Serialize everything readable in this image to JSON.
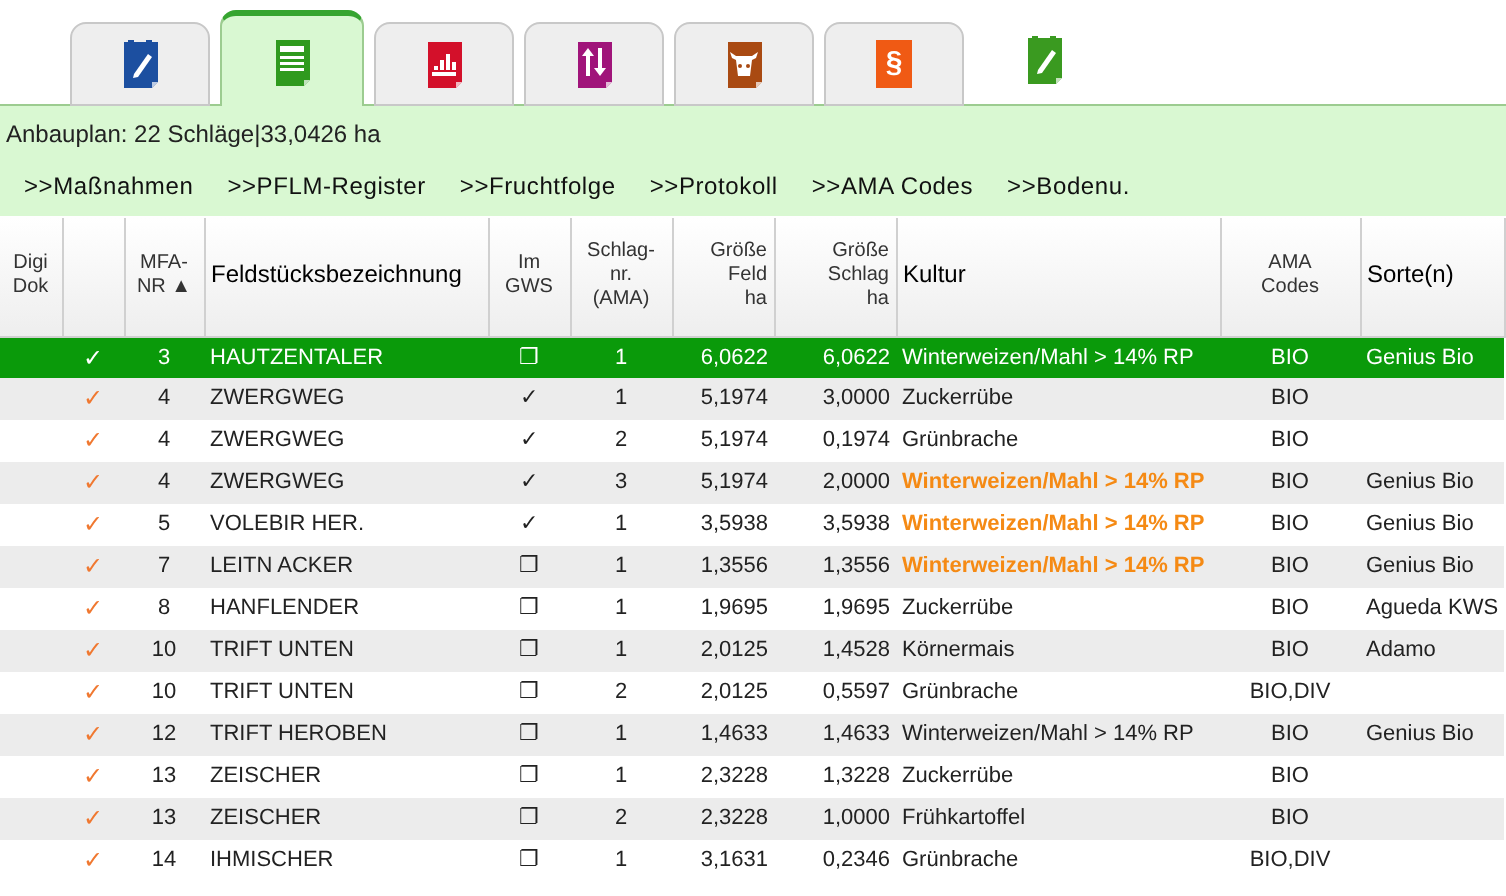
{
  "tabs": [
    {
      "selected": false
    },
    {
      "selected": true
    },
    {
      "selected": false
    },
    {
      "selected": false
    },
    {
      "selected": false
    },
    {
      "glyph": "§",
      "selected": false
    },
    {
      "selected": false
    }
  ],
  "summary": "Anbauplan: 22 Schläge|33,0426 ha",
  "links": [
    ">>Maßnahmen",
    ">>PFLM-Register",
    ">>Fruchtfolge",
    ">>Protokoll",
    ">>AMA Codes",
    ">>Bodenu."
  ],
  "table": {
    "columns": [
      "Digi\nDok",
      "",
      "MFA-\nNR ▲",
      "Feldstücksbezeichnung",
      "Im\nGWS",
      "Schlag-\nnr.\n(AMA)",
      "Größe\nFeld\nha",
      "Größe\nSchlag\nha",
      "Kultur",
      "AMA\nCodes",
      "Sorte(n)"
    ],
    "rows": [
      {
        "selected": true,
        "highlight": false,
        "check": "✓",
        "mfa": "3",
        "name": "HAUTZENTALER",
        "gws": "❐",
        "nr": "1",
        "feld": "6,0622",
        "schlag": "6,0622",
        "kultur": "Winterweizen/Mahl > 14% RP",
        "ama": "BIO",
        "sorte": "Genius Bio"
      },
      {
        "selected": false,
        "highlight": false,
        "check": "✓",
        "mfa": "4",
        "name": "ZWERGWEG",
        "gws": "✓",
        "nr": "1",
        "feld": "5,1974",
        "schlag": "3,0000",
        "kultur": "Zuckerrübe",
        "ama": "BIO"
      },
      {
        "selected": false,
        "highlight": false,
        "check": "✓",
        "mfa": "4",
        "name": "ZWERGWEG",
        "gws": "✓",
        "nr": "2",
        "feld": "5,1974",
        "schlag": "0,1974",
        "kultur": "Grünbrache",
        "ama": "BIO"
      },
      {
        "selected": false,
        "highlight": true,
        "check": "✓",
        "mfa": "4",
        "name": "ZWERGWEG",
        "gws": "✓",
        "nr": "3",
        "feld": "5,1974",
        "schlag": "2,0000",
        "kultur": "Winterweizen/Mahl > 14% RP",
        "ama": "BIO",
        "sorte": "Genius Bio"
      },
      {
        "selected": false,
        "highlight": true,
        "check": "✓",
        "mfa": "5",
        "name": "VOLEBIR HER.",
        "gws": "✓",
        "nr": "1",
        "feld": "3,5938",
        "schlag": "3,5938",
        "kultur": "Winterweizen/Mahl > 14% RP",
        "ama": "BIO",
        "sorte": "Genius Bio"
      },
      {
        "selected": false,
        "highlight": true,
        "check": "✓",
        "mfa": "7",
        "name": "LEITN ACKER",
        "gws": "❐",
        "nr": "1",
        "feld": "1,3556",
        "schlag": "1,3556",
        "kultur": "Winterweizen/Mahl > 14% RP",
        "ama": "BIO",
        "sorte": "Genius Bio"
      },
      {
        "selected": false,
        "highlight": false,
        "check": "✓",
        "mfa": "8",
        "name": "HANFLENDER",
        "gws": "❐",
        "nr": "1",
        "feld": "1,9695",
        "schlag": "1,9695",
        "kultur": "Zuckerrübe",
        "ama": "BIO",
        "sorte": "Agueda KWS"
      },
      {
        "selected": false,
        "highlight": false,
        "check": "✓",
        "mfa": "10",
        "name": "TRIFT UNTEN",
        "gws": "❐",
        "nr": "1",
        "feld": "2,0125",
        "schlag": "1,4528",
        "kultur": "Körnermais",
        "ama": "BIO",
        "sorte": "Adamo"
      },
      {
        "selected": false,
        "highlight": false,
        "check": "✓",
        "mfa": "10",
        "name": "TRIFT UNTEN",
        "gws": "❐",
        "nr": "2",
        "feld": "2,0125",
        "schlag": "0,5597",
        "kultur": "Grünbrache",
        "ama": "BIO,DIV"
      },
      {
        "selected": false,
        "highlight": false,
        "check": "✓",
        "mfa": "12",
        "name": "TRIFT HEROBEN",
        "gws": "❐",
        "nr": "1",
        "feld": "1,4633",
        "schlag": "1,4633",
        "kultur": "Winterweizen/Mahl > 14% RP",
        "ama": "BIO",
        "sorte": "Genius Bio"
      },
      {
        "selected": false,
        "highlight": false,
        "check": "✓",
        "mfa": "13",
        "name": "ZEISCHER",
        "gws": "❐",
        "nr": "1",
        "feld": "2,3228",
        "schlag": "1,3228",
        "kultur": "Zuckerrübe",
        "ama": "BIO"
      },
      {
        "selected": false,
        "highlight": false,
        "check": "✓",
        "mfa": "13",
        "name": "ZEISCHER",
        "gws": "❐",
        "nr": "2",
        "feld": "2,3228",
        "schlag": "1,0000",
        "kultur": "Frühkartoffel",
        "ama": "BIO"
      },
      {
        "selected": false,
        "highlight": false,
        "check": "✓",
        "mfa": "14",
        "name": "IHMISCHER",
        "gws": "❐",
        "nr": "1",
        "feld": "3,1631",
        "schlag": "0,2346",
        "kultur": "Grünbrache",
        "ama": "BIO,DIV"
      }
    ]
  }
}
